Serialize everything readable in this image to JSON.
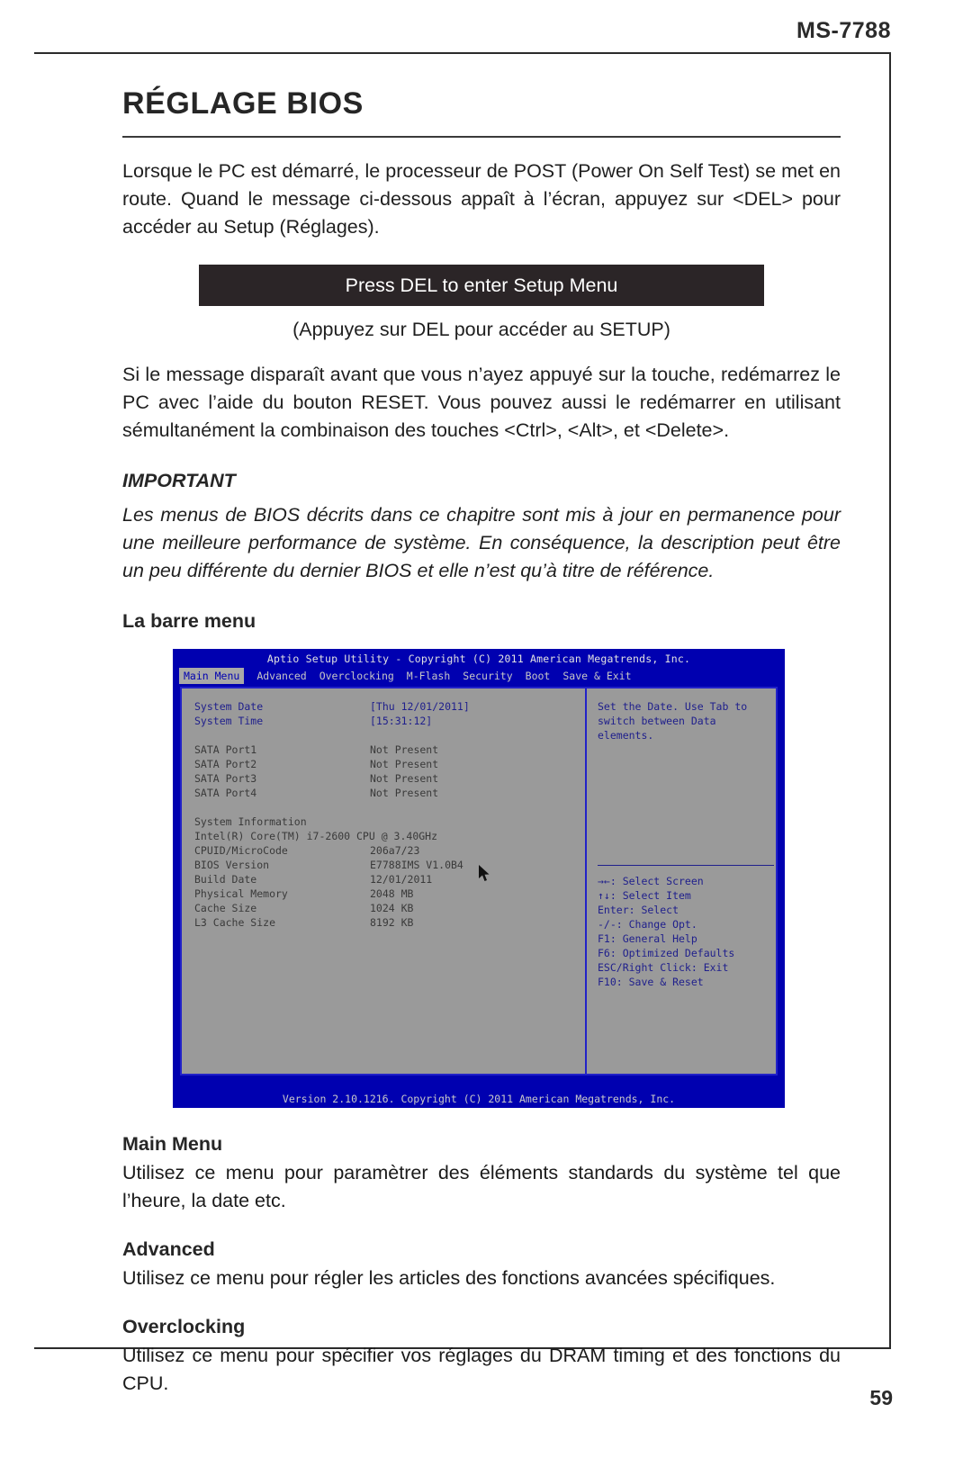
{
  "page": {
    "board_id": "MS-7788",
    "page_number": "59"
  },
  "chapter": {
    "title": "RÉGLAGE BIOS",
    "intro": "Lorsque le PC est démarré, le processeur de POST (Power On Self Test) se met en route. Quand le message ci-dessous appaît à l’écran, appuyez sur <DEL> pour accéder au Setup (Réglages).",
    "post_banner": "Press DEL to enter Setup Menu",
    "post_caption": "(Appuyez sur DEL pour accéder au SETUP)",
    "reset_note": "Si le message disparaît avant que vous n’ayez appuyé sur la touche, redémarrez le PC avec l’aide du bouton RESET. Vous pouvez aussi le redémarrer en utilisant sémultanément la combinaison des touches <Ctrl>, <Alt>, et <Delete>.",
    "important_heading": "IMPORTANT",
    "important_text": "Les menus de BIOS décrits dans ce chapitre sont mis à jour en permanence pour une meilleure performance de système. En conséquence, la description peut être un peu différente du dernier BIOS et elle n’est qu’à titre de référence.",
    "menubar_heading": "La barre menu"
  },
  "bios": {
    "title": "Aptio Setup Utility - Copyright (C) 2011 American Megatrends, Inc.",
    "tabs": [
      {
        "label": "Main Menu",
        "active": true
      },
      {
        "label": "Advanced",
        "active": false
      },
      {
        "label": "Overclocking",
        "active": false
      },
      {
        "label": "M-Flash",
        "active": false
      },
      {
        "label": "Security",
        "active": false
      },
      {
        "label": "Boot",
        "active": false
      },
      {
        "label": "Save & Exit",
        "active": false
      }
    ],
    "settings": [
      {
        "label": "System Date",
        "value": "[Thu 12/01/2011]",
        "highlight": true
      },
      {
        "label": "System Time",
        "value": "[15:31:12]",
        "highlight": true
      }
    ],
    "sata": [
      {
        "label": "SATA Port1",
        "value": "Not Present"
      },
      {
        "label": "SATA Port2",
        "value": "Not Present"
      },
      {
        "label": "SATA Port3",
        "value": "Not Present"
      },
      {
        "label": "SATA Port4",
        "value": "Not Present"
      }
    ],
    "system_information_heading": "System Information",
    "cpu_string": "Intel(R) Core(TM) i7-2600 CPU @ 3.40GHz",
    "system_information": [
      {
        "label": "CPUID/MicroCode",
        "value": "206a7/23"
      },
      {
        "label": "BIOS Version",
        "value": "E7788IMS V1.0B4"
      },
      {
        "label": "Build Date",
        "value": "12/01/2011"
      },
      {
        "label": "Physical Memory",
        "value": "2048 MB"
      },
      {
        "label": "Cache Size",
        "value": "1024 KB"
      },
      {
        "label": "L3 Cache Size",
        "value": "8192 KB"
      }
    ],
    "help_line1": "Set the Date. Use Tab to",
    "help_line2": "switch between Data elements.",
    "keys": [
      "→←: Select Screen",
      "↑↓: Select Item",
      "Enter: Select",
      "-/-: Change Opt.",
      "F1: General Help",
      "F6: Optimized Defaults",
      "ESC/Right Click: Exit",
      "F10: Save & Reset"
    ],
    "footer": "Version 2.10.1216. Copyright (C) 2011 American Megatrends, Inc."
  },
  "sections": [
    {
      "heading": "Main Menu",
      "text": "Utilisez ce menu pour paramètrer des éléments standards du système tel que l’heure, la date etc."
    },
    {
      "heading": "Advanced",
      "text": "Utilisez ce menu pour régler les articles des fonctions avancées spécifiques."
    },
    {
      "heading": "Overclocking",
      "text": "Utilisez ce menu pour spécifier vos réglages du DRAM timing et des fonctions du CPU."
    }
  ]
}
